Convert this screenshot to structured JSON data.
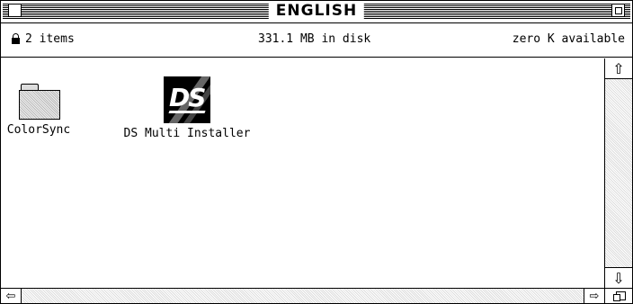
{
  "window": {
    "title": "ENGLISH"
  },
  "header": {
    "item_count": "2 items",
    "disk_usage": "331.1 MB in disk",
    "available": "zero K available"
  },
  "items": [
    {
      "label": "ColorSync",
      "icon": "folder-icon"
    },
    {
      "label": "DS Multi Installer",
      "icon": "installer-app-icon",
      "badge_text": "DS"
    }
  ],
  "scrollbars": {
    "up_glyph": "⇧",
    "down_glyph": "⇩",
    "left_glyph": "⇦",
    "right_glyph": "⇨"
  }
}
